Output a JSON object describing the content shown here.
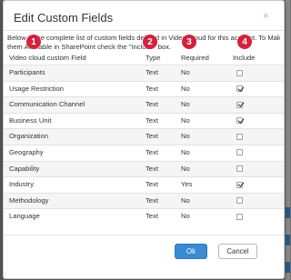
{
  "dialog": {
    "title": "Edit Custom Fields",
    "close_glyph": "×",
    "description_line1": "Below is the complete list of custom fields defined in Video Cloud for this account. To Make",
    "description_line2": "them Available in SharePoint check the \"Include\" box."
  },
  "markers": [
    "1",
    "2",
    "3",
    "4"
  ],
  "marker_color": "#d4213d",
  "columns": {
    "field": "Video cloud custom Field",
    "type": "Type",
    "required": "Required",
    "include": "Include"
  },
  "rows": [
    {
      "field": "Participants",
      "type": "Text",
      "required": "No",
      "include": false
    },
    {
      "field": "Usage Restriction",
      "type": "Text",
      "required": "No",
      "include": true
    },
    {
      "field": "Communication Channel",
      "type": "Text",
      "required": "No",
      "include": true
    },
    {
      "field": "Business Unit",
      "type": "Text",
      "required": "No",
      "include": true
    },
    {
      "field": "Organization",
      "type": "Text",
      "required": "No",
      "include": false
    },
    {
      "field": "Geography",
      "type": "Text",
      "required": "No",
      "include": false
    },
    {
      "field": "Capability",
      "type": "Text",
      "required": "No",
      "include": false
    },
    {
      "field": "Industry",
      "type": "Text",
      "required": "Yes",
      "include": true
    },
    {
      "field": "Methodology",
      "type": "Text",
      "required": "No",
      "include": false
    },
    {
      "field": "Language",
      "type": "Text",
      "required": "No",
      "include": false
    }
  ],
  "buttons": {
    "ok": "Ok",
    "cancel": "Cancel"
  },
  "colors": {
    "primary_button": "#3a8ad4",
    "backdrop": "#6e6e6e"
  }
}
